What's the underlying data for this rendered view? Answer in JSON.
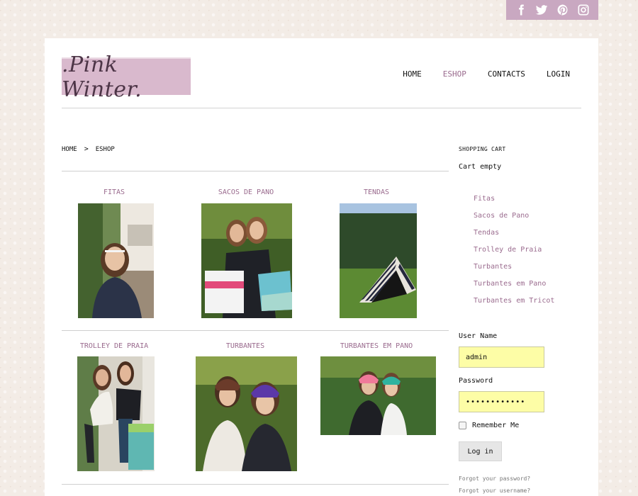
{
  "social": {
    "icons": [
      "facebook-icon",
      "twitter-icon",
      "pinterest-icon",
      "instagram-icon"
    ]
  },
  "logo": {
    "text": ".Pink Winter."
  },
  "nav": {
    "items": [
      {
        "label": "HOME"
      },
      {
        "label": "ESHOP",
        "active": true
      },
      {
        "label": "CONTACTS"
      },
      {
        "label": "LOGIN"
      }
    ]
  },
  "breadcrumb": {
    "home": "HOME",
    "separator": ">",
    "current": "ESHOP"
  },
  "products": [
    {
      "title": "FITAS"
    },
    {
      "title": "SACOS DE PANO"
    },
    {
      "title": "TENDAS"
    },
    {
      "title": "TROLLEY DE PRAIA"
    },
    {
      "title": "TURBANTES"
    },
    {
      "title": "TURBANTES EM PANO"
    }
  ],
  "cart": {
    "title": "SHOPPING CART",
    "status": "Cart empty"
  },
  "categories": [
    "Fitas",
    "Sacos de Pano",
    "Tendas",
    "Trolley de Praia",
    "Turbantes",
    "Turbantes em Pano",
    "Turbantes em Tricot"
  ],
  "login": {
    "username_label": "User Name",
    "username_value": "admin",
    "password_label": "Password",
    "password_value": "••••••••••••",
    "remember_label": "Remember Me",
    "button_label": "Log in",
    "forgot_password": "Forgot your password?",
    "forgot_username": "Forgot your username?"
  },
  "colors": {
    "accent": "#9a6b8e",
    "social_bar": "#c9a8c1",
    "logo_bg": "#d9b9cd",
    "field_bg": "#fdfda6"
  }
}
